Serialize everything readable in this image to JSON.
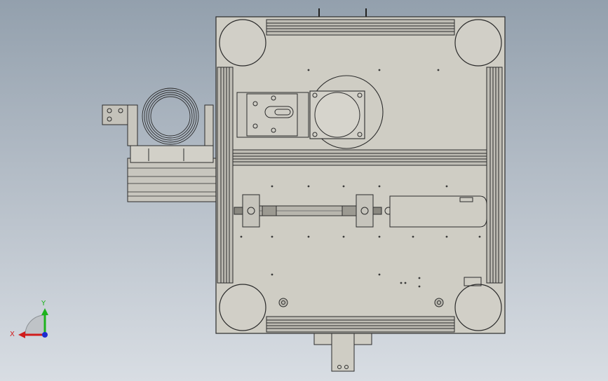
{
  "viewport": {
    "background_top": "#93a0ad",
    "background_bottom": "#d8dde3"
  },
  "model": {
    "plate_color": "#cfcdc4",
    "line_color": "#2b2b2b",
    "profile_color": "#bfbdb5"
  },
  "triad": {
    "x_label": "X",
    "y_label": "Y",
    "x_color": "#d01c1c",
    "y_color": "#1db31d",
    "z_color": "#1c2bd0"
  }
}
